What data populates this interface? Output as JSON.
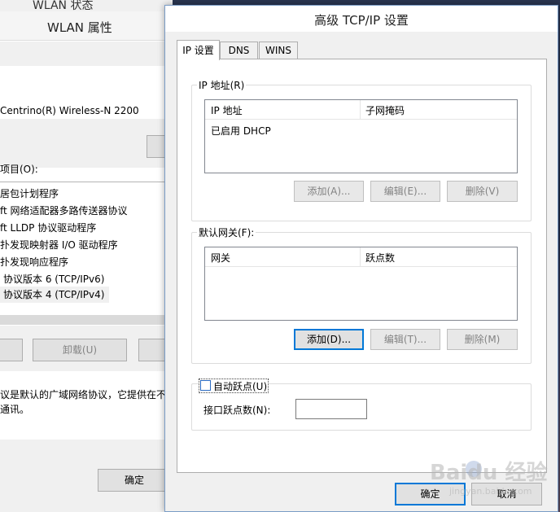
{
  "background_window": {
    "status_title": "WLAN 状态",
    "title": "WLAN 属性",
    "adapter_name": "Centrino(R) Wireless-N 2200",
    "items_label": "项目(O):",
    "items": [
      "居包计划程序",
      "ft 网络适配器多路传送器协议",
      "ft LLDP 协议驱动程序",
      "扑发现映射器 I/O 驱动程序",
      "扑发现响应程序",
      "协议版本 6 (TCP/IPv6)",
      "协议版本 4 (TCP/IPv4)"
    ],
    "uninstall_button": "卸载(U)",
    "description_line1": "议是默认的广域网络协议，它提供在不",
    "description_line2": "通讯。",
    "ok_button": "确定"
  },
  "dialog": {
    "title": "高级 TCP/IP 设置",
    "tabs": [
      {
        "label": "IP 设置",
        "active": true
      },
      {
        "label": "DNS",
        "active": false
      },
      {
        "label": "WINS",
        "active": false
      }
    ],
    "ip_group": {
      "label": "IP 地址(R)",
      "columns": [
        "IP 地址",
        "子网掩码"
      ],
      "rows": [
        "已启用 DHCP"
      ],
      "add_button": "添加(A)...",
      "edit_button": "编辑(E)...",
      "remove_button": "删除(V)"
    },
    "gateway_group": {
      "label": "默认网关(F):",
      "columns": [
        "网关",
        "跃点数"
      ],
      "add_button": "添加(D)...",
      "edit_button": "编辑(T)...",
      "remove_button": "删除(M)"
    },
    "metric": {
      "auto_metric_label": "自动跃点(U)",
      "auto_metric_checked": false,
      "interface_metric_label": "接口跃点数(N):",
      "interface_metric_value": ""
    },
    "ok_button": "确定",
    "cancel_button": "取消"
  },
  "watermark": {
    "text": "Baidu 经验",
    "sub": "jingyan.baidu.com"
  }
}
